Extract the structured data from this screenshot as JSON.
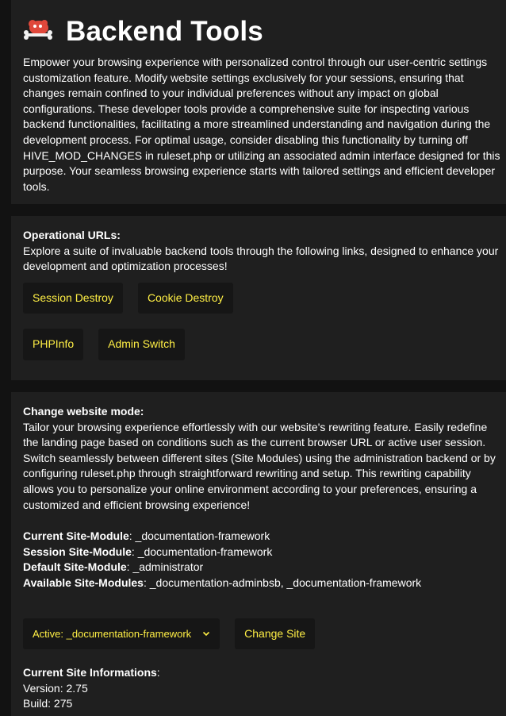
{
  "header": {
    "title": "Backend Tools",
    "description": "Empower your browsing experience with personalized control through our user-centric settings customization feature. Modify website settings exclusively for your sessions, ensuring that changes remain confined to your individual preferences without any impact on global configurations. These developer tools provide a comprehensive suite for inspecting various backend functionalities, facilitating a more streamlined understanding and navigation during the development process. For optimal usage, consider disabling this functionality by turning off HIVE_MOD_CHANGES in ruleset.php or utilizing an associated admin interface designed for this purpose. Your seamless browsing experience starts with tailored settings and efficient developer tools."
  },
  "urls": {
    "heading": "Operational URLs:",
    "description": "Explore a suite of invaluable backend tools through the following links, designed to enhance your development and optimization processes!",
    "buttons": [
      "Session Destroy",
      "Cookie Destroy",
      "PHPInfo",
      "Admin Switch"
    ]
  },
  "mode": {
    "heading": "Change website mode:",
    "description": "Tailor your browsing experience effortlessly with our website's rewriting feature. Easily redefine the landing page based on conditions such as the current browser URL or active user session. Switch seamlessly between different sites (Site Modules) using the administration backend or by configuring ruleset.php through straightforward rewriting and setup. This rewriting capability allows you to personalize your online environment according to your preferences, ensuring a customized and efficient browsing experience!",
    "current_label": "Current Site-Module",
    "current_value": ": _documentation-framework",
    "session_label": "Session Site-Module",
    "session_value": ": _documentation-framework",
    "default_label": "Default Site-Module",
    "default_value": ": _administrator",
    "available_label": "Available Site-Modules",
    "available_value": ": _documentation-adminbsb, _documentation-framework",
    "select_value": "Active: _documentation-framework",
    "change_button": "Change Site",
    "info_label": "Current Site Informations",
    "info_colon": ":",
    "version": "Version: 2.75",
    "build": "Build: 275"
  },
  "colors": {
    "background": "#121212",
    "panel": "#1f1f1f",
    "button_text": "#ffef45",
    "logo_red": "#e0483b"
  },
  "icons": {
    "logo": "red-creature-logo-icon",
    "select": "chevron-down-icon"
  }
}
